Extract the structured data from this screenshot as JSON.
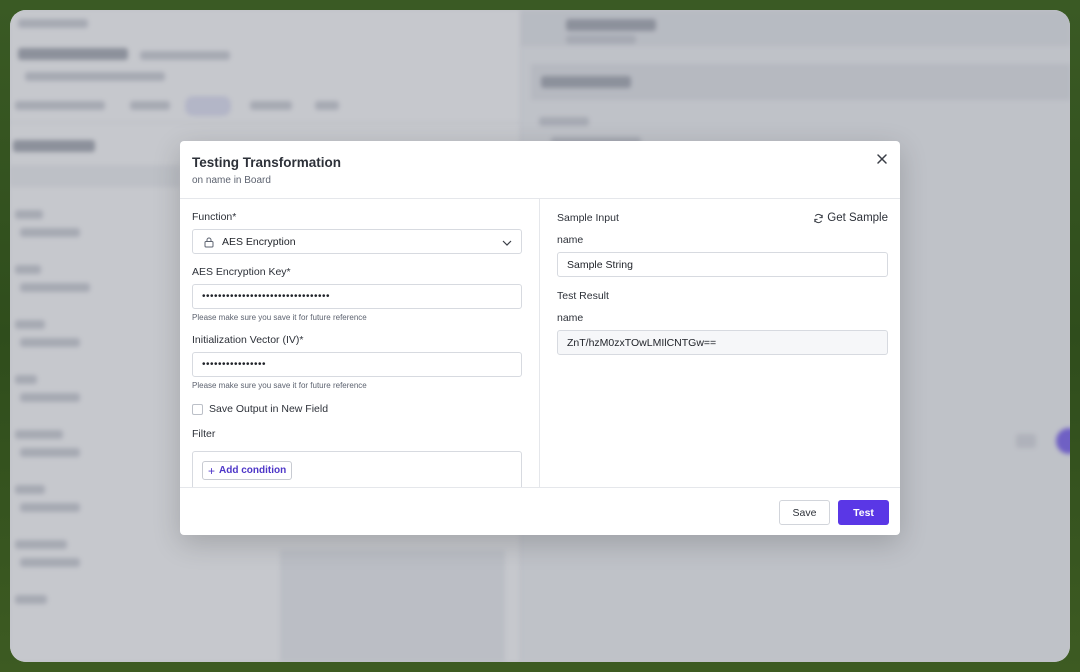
{
  "modal": {
    "title": "Testing Transformation",
    "subtitle": "on name in Board",
    "function_label": "Function*",
    "function_value": "AES Encryption",
    "key_label": "AES Encryption Key*",
    "key_value": "••••••••••••••••••••••••••••••••",
    "key_hint": "Please make sure you save it for future reference",
    "iv_label": "Initialization Vector (IV)*",
    "iv_value": "••••••••••••••••",
    "iv_hint": "Please make sure you save it for future reference",
    "save_output_label": "Save Output in New Field",
    "save_output_checked": false,
    "filter_label": "Filter",
    "add_condition_label": "Add condition",
    "sample_input_label": "Sample Input",
    "get_sample_label": "Get Sample",
    "input_field_name": "name",
    "input_value": "Sample String",
    "test_result_label": "Test Result",
    "result_field_name": "name",
    "result_value": "ZnT/hzM0zxTOwLMIlCNTGw==",
    "save_button": "Save",
    "test_button": "Test"
  },
  "colors": {
    "accent": "#5a37e6",
    "overlay": "#787c87",
    "frame": "#3a5a24"
  },
  "icons": {
    "close": "close-icon",
    "lock": "lock-icon",
    "chevron": "chevron-down-icon",
    "refresh": "refresh-icon",
    "plus": "plus-icon"
  }
}
